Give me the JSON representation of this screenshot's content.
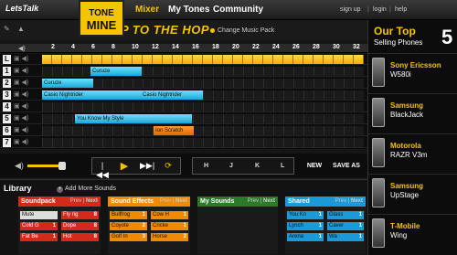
{
  "header": {
    "brand": "LetsTalk",
    "logo_line1": "TONE",
    "logo_line2": "MINE",
    "nav": [
      "Mixer",
      "My Tones",
      "Community"
    ],
    "util": [
      "sign up",
      "login",
      "help"
    ]
  },
  "toolbar": {
    "pack_title": "HIP TO THE HOP",
    "change_pack": "Change Music Pack"
  },
  "ruler": {
    "ticks": [
      "2",
      "4",
      "6",
      "8",
      "10",
      "12",
      "14",
      "16",
      "18",
      "20",
      "22",
      "24",
      "26",
      "28",
      "30",
      "32"
    ]
  },
  "tracks": [
    {
      "num": "L",
      "clips": []
    },
    {
      "num": "1",
      "clips": [
        {
          "label": "Curuze"
        }
      ]
    },
    {
      "num": "2",
      "clips": [
        {
          "label": "Curuze"
        }
      ]
    },
    {
      "num": "3",
      "clips": [
        {
          "label": "Casio Nightrider"
        },
        {
          "label": "Casio Nightrider"
        }
      ]
    },
    {
      "num": "4",
      "clips": []
    },
    {
      "num": "5",
      "clips": [
        {
          "label": "You Know My Style"
        }
      ]
    },
    {
      "num": "6",
      "clips": [
        {
          "label": "Ion Scratch"
        }
      ]
    },
    {
      "num": "7",
      "clips": []
    }
  ],
  "transport": {
    "rewind": "|◀◀",
    "play": "▶",
    "forward": "▶▶|",
    "loop": "⟳",
    "keys": [
      "H",
      "J",
      "K",
      "L"
    ],
    "new_label": "NEW",
    "save_label": "SAVE AS"
  },
  "library": {
    "title": "Library",
    "add_sounds": "Add More Sounds",
    "panels": [
      {
        "title": "Soundpack",
        "prev": "Prev",
        "next": "Next",
        "items": [
          {
            "label": "Mute",
            "n": ""
          },
          {
            "label": "Cold G",
            "n": "1"
          },
          {
            "label": "Fat Be",
            "n": "1"
          },
          {
            "label": "Fly rig",
            "n": "8"
          },
          {
            "label": "Dope",
            "n": "8"
          },
          {
            "label": "Hot",
            "n": "8"
          }
        ]
      },
      {
        "title": "Sound Effects",
        "prev": "Prev",
        "next": "Next",
        "items": [
          {
            "label": "Bullfrog",
            "n": "1"
          },
          {
            "label": "Coyote",
            "n": "2"
          },
          {
            "label": "Golf In",
            "n": "3"
          },
          {
            "label": "Cow H",
            "n": "1"
          },
          {
            "label": "Cricke",
            "n": "1"
          },
          {
            "label": "Horse",
            "n": "2"
          }
        ]
      },
      {
        "title": "My Sounds",
        "prev": "Prev",
        "next": "Next",
        "items": []
      },
      {
        "title": "Shared",
        "prev": "Prev",
        "next": "Next",
        "items": [
          {
            "label": "You Kn",
            "n": "1"
          },
          {
            "label": "Lynch",
            "n": "1"
          },
          {
            "label": "Arena",
            "n": "1"
          },
          {
            "label": "Glass",
            "n": "1"
          },
          {
            "label": "Caver",
            "n": "1"
          },
          {
            "label": "Wa",
            "n": "1"
          }
        ]
      }
    ]
  },
  "promo": {
    "title": "Our Top",
    "subtitle": "Selling Phones",
    "number": "5",
    "phones": [
      {
        "brand": "Sony Ericsson",
        "model": "W580i"
      },
      {
        "brand": "Samsung",
        "model": "BlackJack"
      },
      {
        "brand": "Motorola",
        "model": "RAZR V3m"
      },
      {
        "brand": "Samsung",
        "model": "UpStage"
      },
      {
        "brand": "T-Mobile",
        "model": "Wing"
      }
    ]
  },
  "colors": {
    "accent": "#f5c400",
    "cyan": "#1aa8d8",
    "orange": "#f08a00",
    "red": "#d32a1a"
  }
}
